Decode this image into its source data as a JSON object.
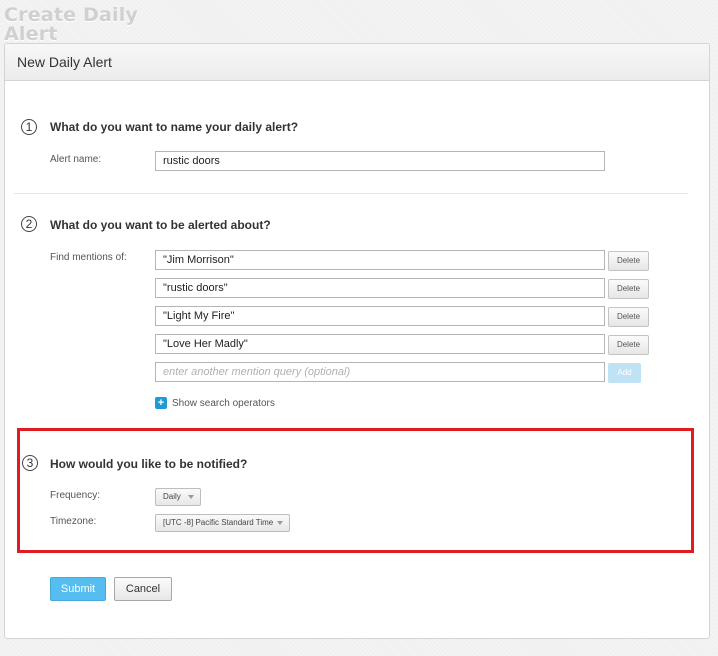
{
  "page": {
    "title": "Create Daily Alert"
  },
  "panel": {
    "title": "New Daily Alert"
  },
  "step1": {
    "number": "1",
    "question": "What do you want to name your daily alert?",
    "label": "Alert name:",
    "value": "rustic doors"
  },
  "step2": {
    "number": "2",
    "question": "What do you want to be alerted about?",
    "label": "Find mentions of:",
    "mentions": [
      {
        "value": "\"Jim Morrison\"",
        "button": "Delete"
      },
      {
        "value": "\"rustic doors\"",
        "button": "Delete"
      },
      {
        "value": "\"Light My Fire\"",
        "button": "Delete"
      },
      {
        "value": "\"Love Her Madly\"",
        "button": "Delete"
      }
    ],
    "new_mention": {
      "placeholder": "enter another mention query (optional)",
      "button": "Add"
    },
    "show_operators": "Show search operators"
  },
  "step3": {
    "number": "3",
    "question": "How would you like to be notified?",
    "frequency_label": "Frequency:",
    "frequency_value": "Daily",
    "timezone_label": "Timezone:",
    "timezone_value": "[UTC -8] Pacific Standard Time"
  },
  "actions": {
    "submit": "Submit",
    "cancel": "Cancel"
  },
  "colors": {
    "highlight": "#e11b22",
    "accent": "#55bdf0"
  },
  "icons": {
    "show_operators": "plus-icon"
  }
}
